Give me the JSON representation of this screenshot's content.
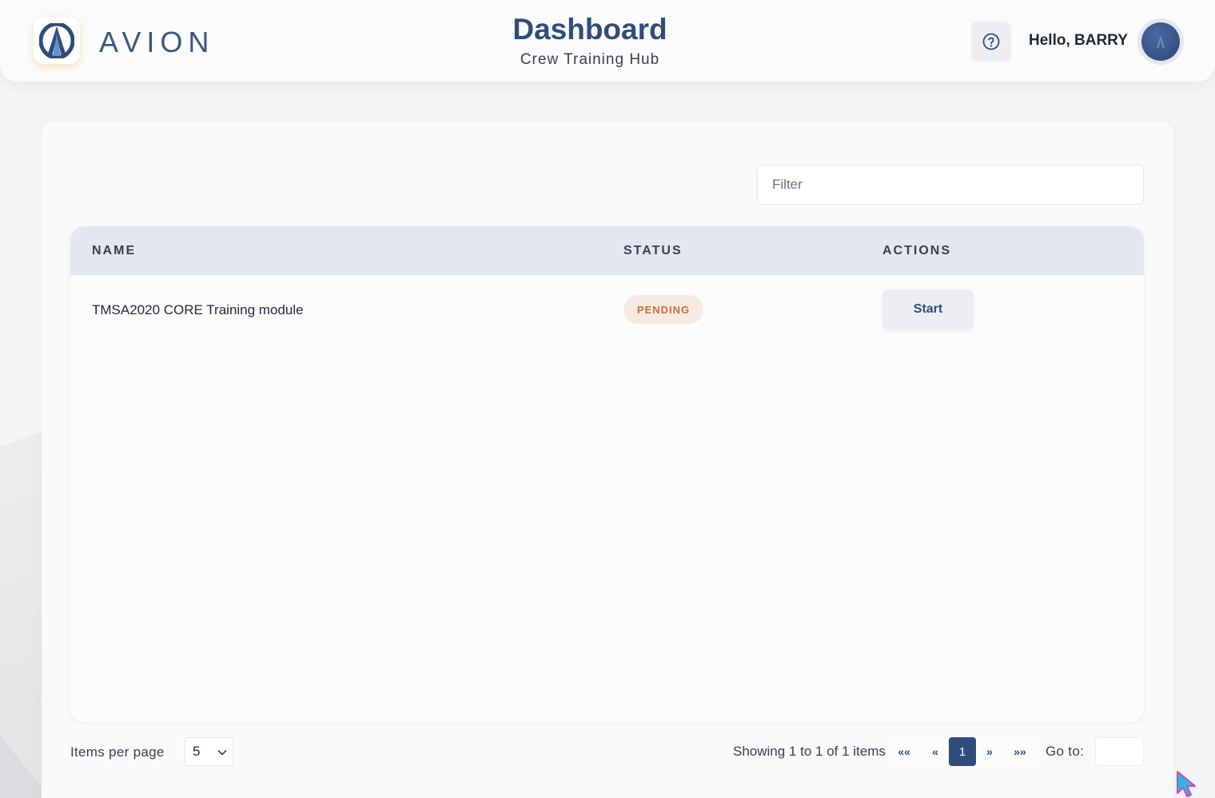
{
  "header": {
    "brand": "AVION",
    "title": "Dashboard",
    "subtitle": "Crew Training Hub",
    "greeting": "Hello, BARRY",
    "help_icon": "question-circle-icon",
    "avatar_icon": "user-avatar"
  },
  "filter": {
    "placeholder": "Filter",
    "value": ""
  },
  "table": {
    "columns": [
      "NAME",
      "STATUS",
      "ACTIONS"
    ],
    "rows": [
      {
        "name": "TMSA2020 CORE Training module",
        "status": "PENDING",
        "action": "Start"
      }
    ]
  },
  "pagination": {
    "items_per_page_label": "Items per page",
    "items_per_page": "5",
    "showing": "Showing 1 to 1 of 1 items",
    "first": "««",
    "prev": "«",
    "current": "1",
    "next": "»",
    "last": "»»",
    "goto_label": "Go to:",
    "goto_value": ""
  },
  "colors": {
    "brand": "#2f4d7c",
    "pending_text": "#c2703a",
    "pending_bg": "#f6ebe2",
    "header_row": "#e3e7ef"
  }
}
